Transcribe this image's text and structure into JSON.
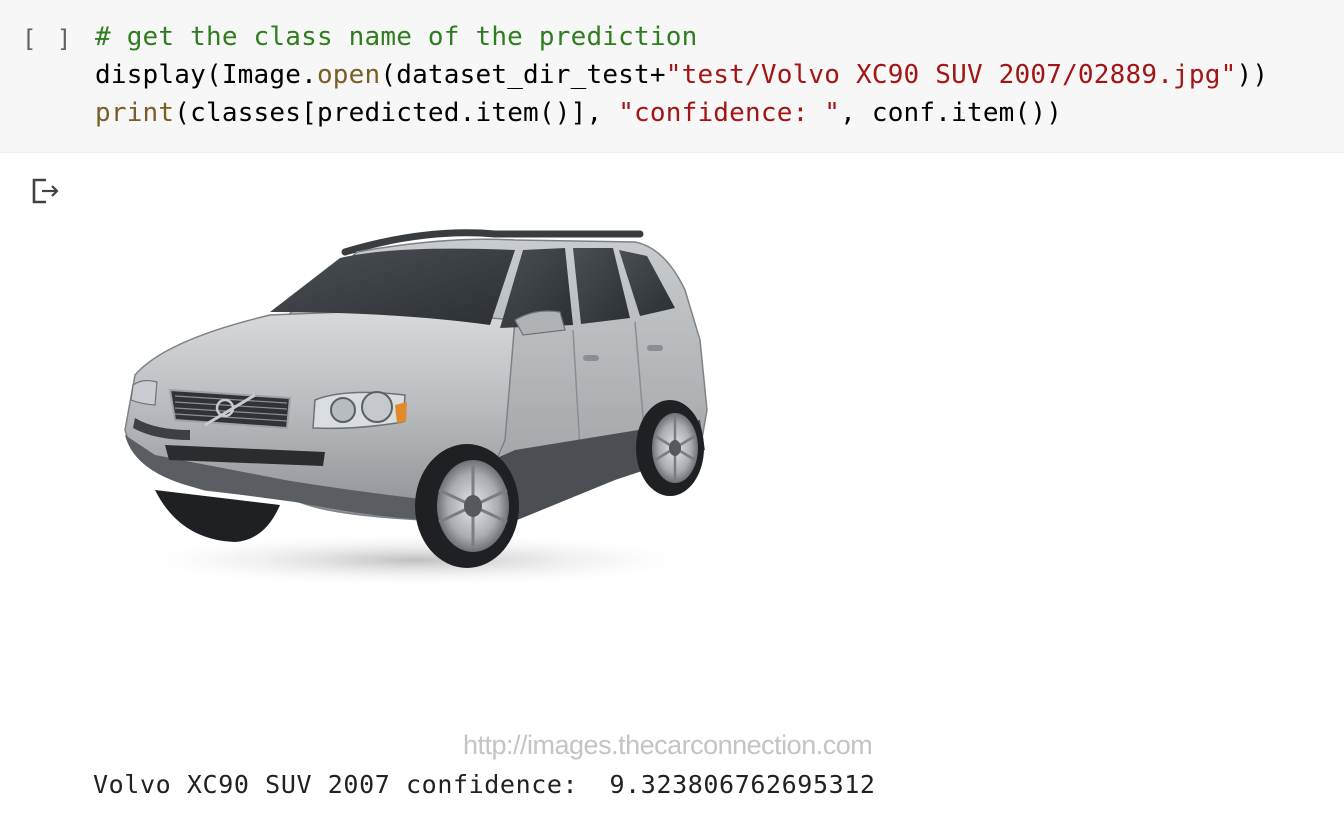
{
  "code_cell": {
    "run_indicator": "[ ]",
    "lines": [
      [
        {
          "cls": "tok-comment",
          "text": "# get the class name of the prediction"
        }
      ],
      [
        {
          "cls": "tok-plain",
          "text": "display(Image."
        },
        {
          "cls": "tok-method",
          "text": "open"
        },
        {
          "cls": "tok-plain",
          "text": "(dataset_dir_test+"
        },
        {
          "cls": "tok-string",
          "text": "\"test/Volvo XC90 SUV 2007/02889.jpg\""
        },
        {
          "cls": "tok-plain",
          "text": "))"
        }
      ],
      [
        {
          "cls": "tok-builtin",
          "text": "print"
        },
        {
          "cls": "tok-plain",
          "text": "(classes[predicted.item()], "
        },
        {
          "cls": "tok-string",
          "text": "\"confidence: \""
        },
        {
          "cls": "tok-plain",
          "text": ", conf.item())"
        }
      ]
    ]
  },
  "output": {
    "icon": "output-redirect-icon",
    "image": {
      "subject": "silver Volvo XC90 SUV",
      "watermark": "http://images.thecarconnection.com"
    },
    "text": "Volvo XC90 SUV 2007 confidence:  9.323806762695312"
  },
  "colors": {
    "cell_background": "#f7f7f7",
    "comment": "#2e7d1f",
    "string": "#a31515",
    "function": "#795e26",
    "car_body": "#b9bcbf"
  }
}
